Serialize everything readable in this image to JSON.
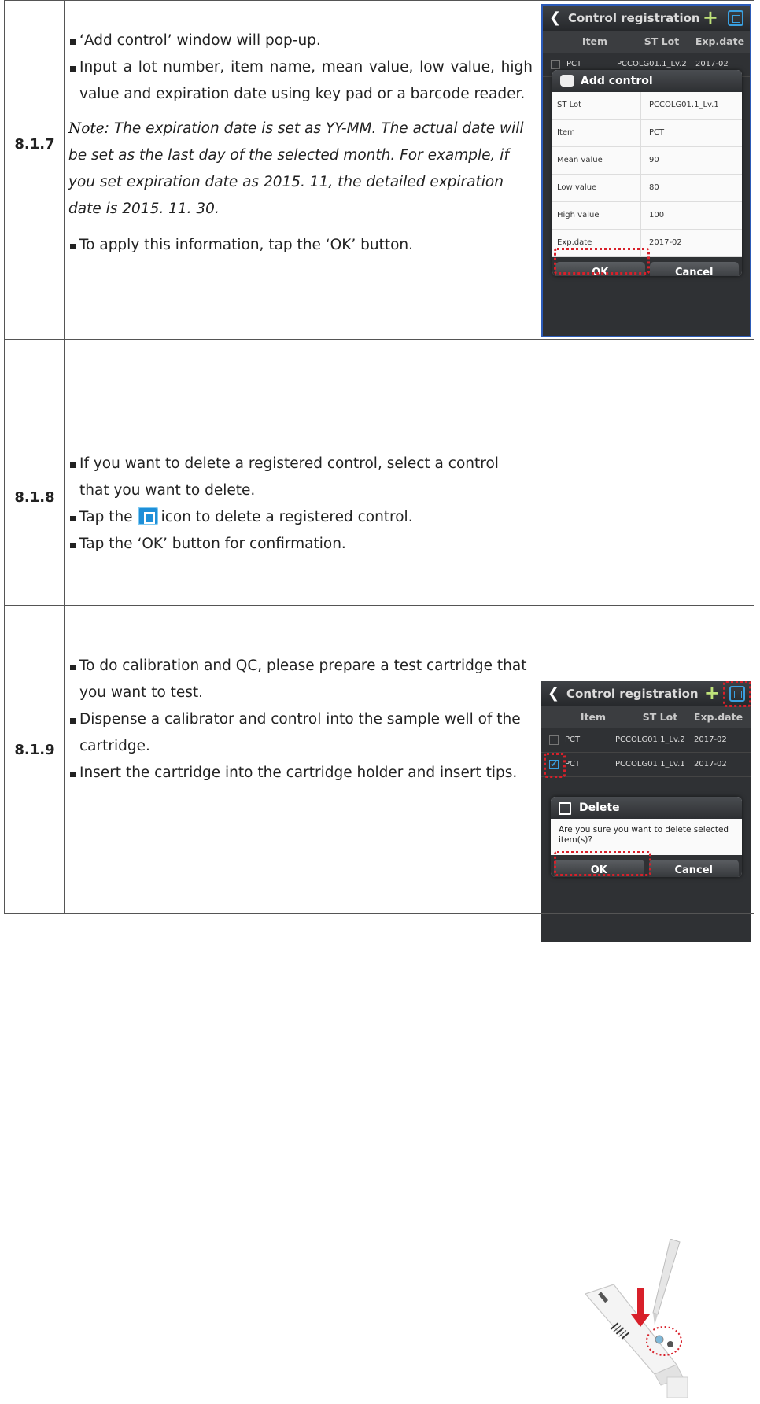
{
  "rows": [
    {
      "step": "8.1.7",
      "bullets_before": [
        "‘Add control’ window will pop-up.",
        "Input a lot number, item name, mean value, low value, high value and expiration date using key pad or a barcode reader."
      ],
      "note_label": "Note",
      "note_text": ": The expiration date is set as YY-MM. The actual date will be set as the last day of the selected month. For example, if you set expiration date as 2015. 11, the detailed expiration date is 2015. 11. 30.",
      "bullets_after": [
        "To apply this information, tap the ‘OK’ button."
      ],
      "screen": {
        "title": "Control registration",
        "columns": [
          "Item",
          "ST Lot",
          "Exp.date"
        ],
        "row_peek": {
          "item": "PCT",
          "lot": "PCCOLG01.1_Lv.2",
          "exp": "2017-02"
        },
        "dialog_title": "Add control",
        "fields": [
          {
            "label": "ST Lot",
            "value": "PCCOLG01.1_Lv.1"
          },
          {
            "label": "Item",
            "value": "PCT"
          },
          {
            "label": "Mean value",
            "value": "90"
          },
          {
            "label": "Low value",
            "value": "80"
          },
          {
            "label": "High value",
            "value": "100"
          },
          {
            "label": "Exp.date",
            "value": "2017-02"
          }
        ],
        "ok": "OK",
        "cancel": "Cancel"
      }
    },
    {
      "step": "8.1.8",
      "bullet1": "If you want to delete a registered control, select a control that you want to delete.",
      "bullet2_pre": "Tap the",
      "bullet2_post": "icon to delete a registered control.",
      "bullet3": "Tap the ‘OK’ button for confirmation.",
      "screen": {
        "title": "Control registration",
        "columns": [
          "Item",
          "ST Lot",
          "Exp.date"
        ],
        "rows": [
          {
            "item": "PCT",
            "lot": "PCCOLG01.1_Lv.2",
            "exp": "2017-02",
            "checked": false
          },
          {
            "item": "PCT",
            "lot": "PCCOLG01.1_Lv.1",
            "exp": "2017-02",
            "checked": true
          }
        ],
        "dialog_title": "Delete",
        "message": "Are you sure you want to delete selected item(s)?",
        "ok": "OK",
        "cancel": "Cancel"
      }
    },
    {
      "step": "8.1.9",
      "bullets": [
        "To do calibration and QC, please prepare a test cartridge that you want to test.",
        "Dispense a calibrator and control into the sample well of the cartridge.",
        "Insert the cartridge into the cartridge holder and insert tips."
      ]
    }
  ],
  "colors": {
    "highlight": "#d8202a",
    "accent": "#1e8fd8",
    "border": "#555555"
  },
  "icons": [
    "back-chevron-icon",
    "plus-icon",
    "trash-icon",
    "chat-bubble-icon",
    "delete-trash-icon",
    "pipette-tip-icon",
    "red-arrow-icon"
  ]
}
